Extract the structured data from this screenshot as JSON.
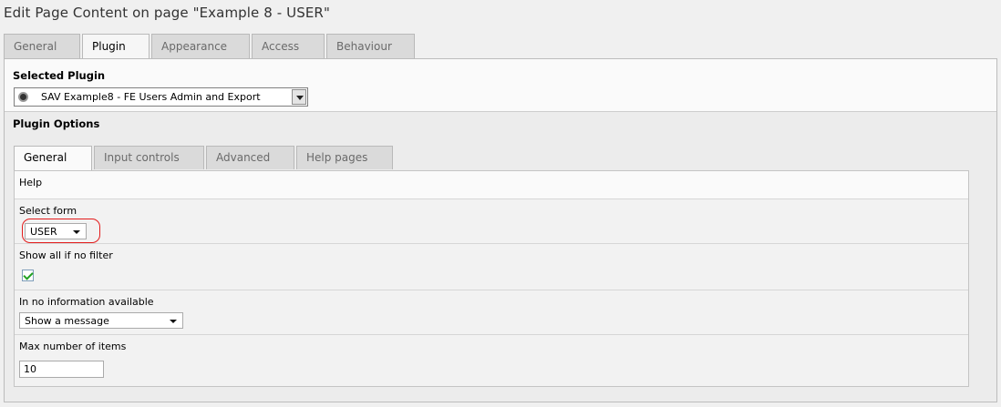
{
  "page": {
    "title": "Edit Page Content on page \"Example 8 - USER\""
  },
  "top_tabs": [
    {
      "label": "General",
      "active": false
    },
    {
      "label": "Plugin",
      "active": true
    },
    {
      "label": "Appearance",
      "active": false
    },
    {
      "label": "Access",
      "active": false
    },
    {
      "label": "Behaviour",
      "active": false
    }
  ],
  "selected_plugin": {
    "heading": "Selected Plugin",
    "value": "SAV Example8 - FE Users Admin and Export"
  },
  "plugin_options": {
    "heading": "Plugin Options",
    "tabs": [
      {
        "label": "General",
        "active": true
      },
      {
        "label": "Input controls",
        "active": false
      },
      {
        "label": "Advanced",
        "active": false
      },
      {
        "label": "Help pages",
        "active": false
      }
    ],
    "help": {
      "label": "Help"
    },
    "select_form": {
      "label": "Select form",
      "value": "USER"
    },
    "show_all": {
      "label": "Show all if no filter",
      "checked": true
    },
    "no_info": {
      "label": "In no information available",
      "value": "Show a message"
    },
    "max_items": {
      "label": "Max number of items",
      "value": "10"
    }
  },
  "colors": {
    "highlight": "#e31b1b",
    "check": "#21a121"
  }
}
